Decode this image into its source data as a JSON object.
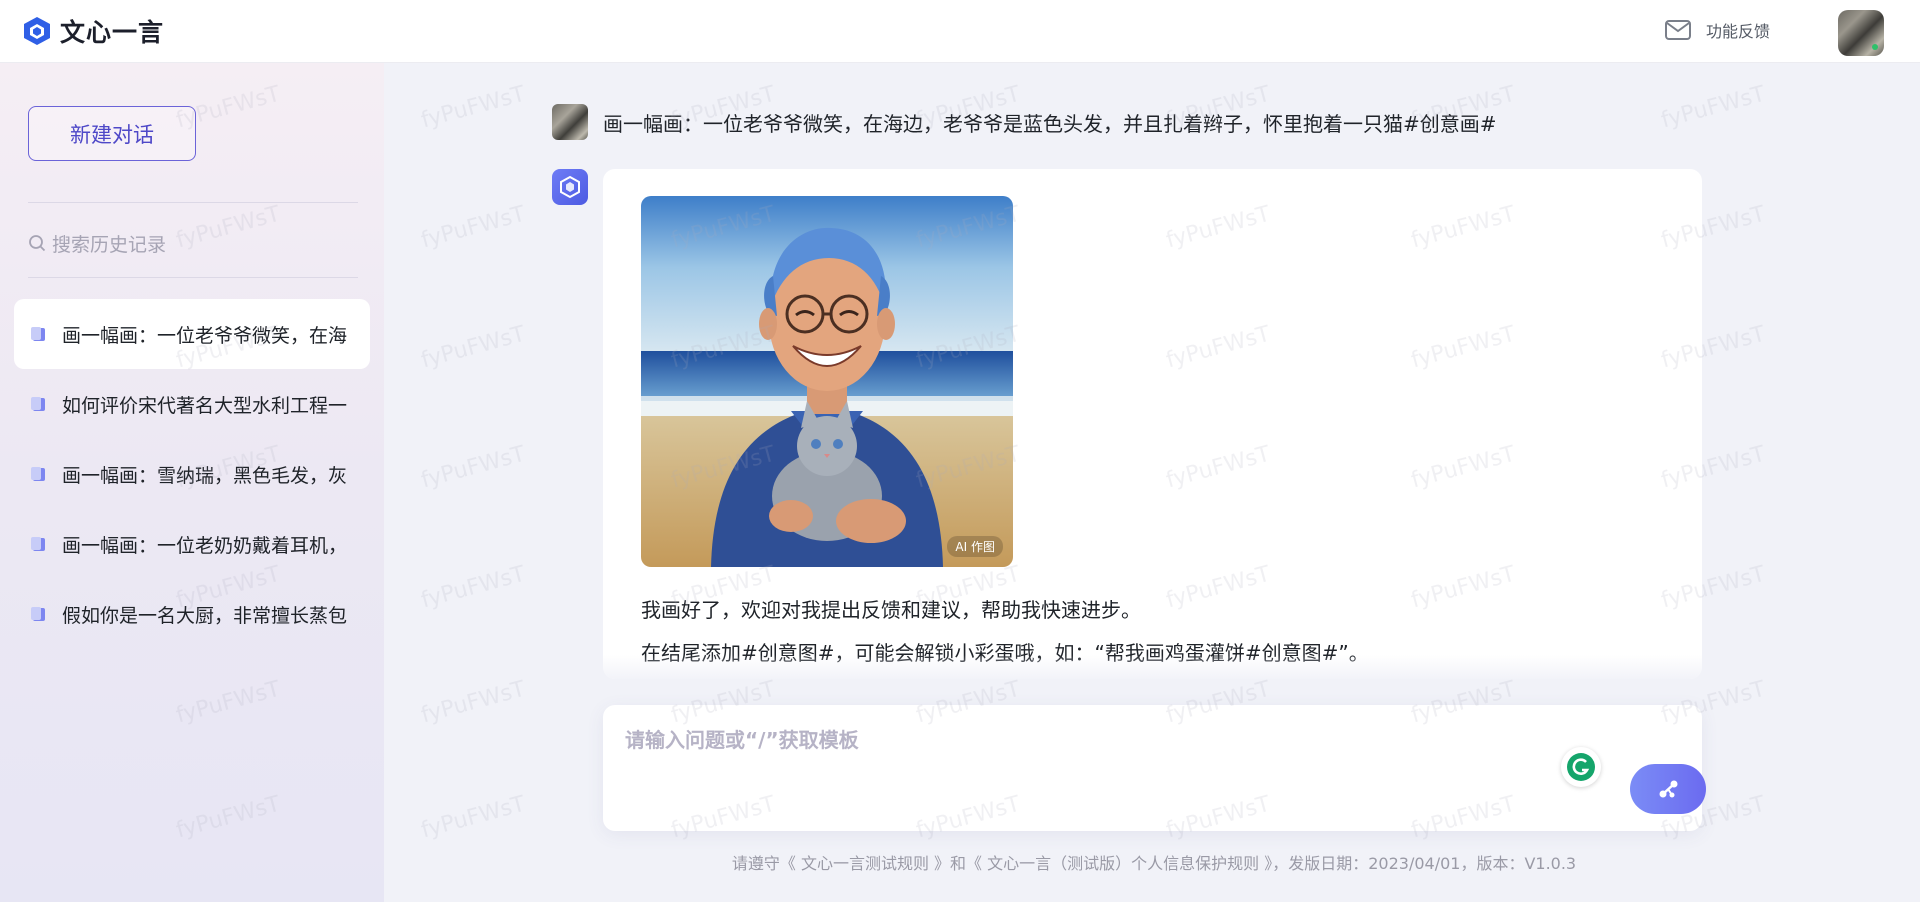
{
  "app": {
    "title": "文心一言",
    "feedback_label": "功能反馈",
    "accent_color": "#4e48c8"
  },
  "sidebar": {
    "new_chat_label": "新建对话",
    "search_placeholder": "搜索历史记录",
    "items": [
      {
        "label": "画一幅画：一位老爷爷微笑，在海",
        "active": true
      },
      {
        "label": "如何评价宋代著名大型水利工程一"
      },
      {
        "label": "画一幅画：雪纳瑞，黑色毛发，灰"
      },
      {
        "label": "画一幅画：一位老奶奶戴着耳机，"
      },
      {
        "label": "假如你是一名大厨，非常擅长蒸包"
      }
    ]
  },
  "chat": {
    "user_message": "画一幅画：一位老爷爷微笑，在海边，老爷爷是蓝色头发，并且扎着辫子，怀里抱着一只猫#创意画#",
    "image_caption": "AI 作图",
    "reply_line1": "我画好了，欢迎对我提出反馈和建议，帮助我快速进步。",
    "reply_line2": "在结尾添加#创意图#，可能会解锁小彩蛋哦，如：“帮我画鸡蛋灌饼#创意图#”。"
  },
  "input": {
    "placeholder": "请输入问题或“/”获取模板",
    "value": ""
  },
  "footer": {
    "text": "请遵守《 文心一言测试规则 》和《 文心一言（测试版）个人信息保护规则 》，发版日期：2023/04/01，版本：V1.0.3"
  },
  "watermark_text": "fyPuFWsT",
  "icons": {
    "logo": "wenxin-logo-icon",
    "feedback": "mail-icon",
    "search": "search-icon",
    "history": "document-icon",
    "grammarly": "grammarly-icon",
    "send": "send-icon"
  }
}
